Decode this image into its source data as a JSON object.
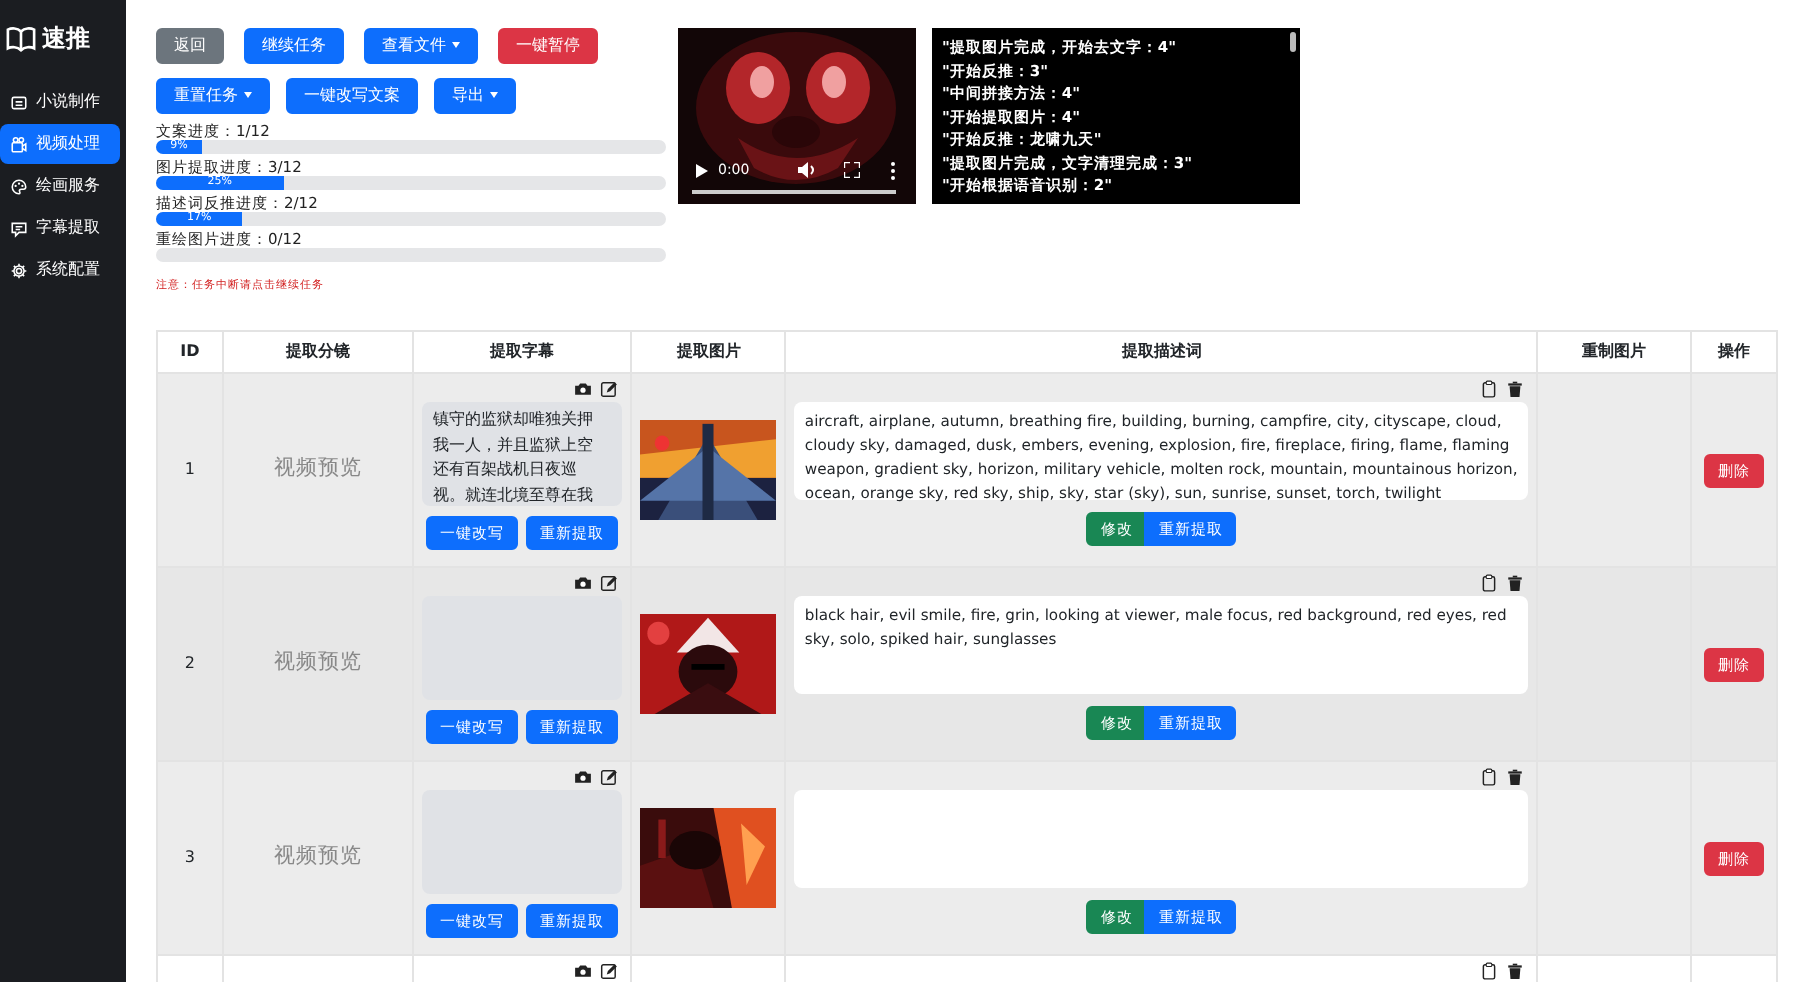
{
  "app": {
    "title": "速推"
  },
  "sidebar": [
    {
      "label": "小说制作",
      "selected": false
    },
    {
      "label": "视频处理",
      "selected": true
    },
    {
      "label": "绘画服务",
      "selected": false
    },
    {
      "label": "字幕提取",
      "selected": false
    },
    {
      "label": "系统配置",
      "selected": false
    }
  ],
  "toolbar": [
    [
      {
        "label": "返回",
        "kind": "secondary",
        "dropdown": false
      },
      {
        "label": "继续任务",
        "kind": "primary",
        "dropdown": false
      },
      {
        "label": "查看文件",
        "kind": "primary",
        "dropdown": true
      },
      {
        "label": "一键暂停",
        "kind": "danger",
        "dropdown": false
      }
    ],
    [
      {
        "label": "重置任务",
        "kind": "primary",
        "dropdown": true
      },
      {
        "label": "一键改写文案",
        "kind": "primary",
        "dropdown": false
      },
      {
        "label": "导出",
        "kind": "primary",
        "dropdown": true
      }
    ]
  ],
  "progress": [
    {
      "label": "文案进度：1/12",
      "level": 0.09,
      "reading": "9%"
    },
    {
      "label": "图片提取进度：3/12",
      "level": 0.25,
      "reading": "25%"
    },
    {
      "label": "描述词反推进度：2/12",
      "level": 0.17,
      "reading": "17%"
    },
    {
      "label": "重绘图片进度：0/12",
      "level": 0
    }
  ],
  "video": {
    "time": "0:00"
  },
  "log": [
    "\"提取图片完成，开始去文字：4\"",
    "\"开始反推：3\"",
    "\"中间拼接方法：4\"",
    "\"开始提取图片：4\"",
    "\"开始反推：龙啸九天\"",
    "\"提取图片完成，文字清理完成：3\"",
    "\"开始根据语音识别：2\""
  ],
  "notice": "注意：任务中断请点击继续任务",
  "table": {
    "columns": [
      "ID",
      "提取分镜",
      "提取字幕",
      "提取图片",
      "提取描述词",
      "重制图片",
      "操作"
    ],
    "rows": [
      {
        "kind": "full",
        "id": "1",
        "preview": "视频预览",
        "subtitle": "镇守的监狱却唯独关押我一人，并且监狱上空还有百架战机日夜巡视。就连北境至尊在我",
        "subtitle_buttons": [
          "一键改写",
          "重新提取"
        ],
        "prompt": "aircraft, airplane, autumn, breathing fire, building, burning, campfire, city, cityscape, cloud, cloudy sky, damaged, dusk, embers, evening, explosion, fire, fireplace, firing, flame, flaming weapon, gradient sky, horizon, military vehicle, molten rock, mountain, mountainous horizon, ocean, orange sky, red sky, ship, sky, star (sky), sun, sunrise, sunset, torch, twilight",
        "prompt_buttons": [
          "修改",
          "重新提取"
        ],
        "action": "删除"
      },
      {
        "kind": "full",
        "id": "2",
        "preview": "视频预览",
        "subtitle_buttons": [
          "一键改写",
          "重新提取"
        ],
        "prompt": "black hair, evil smile, fire, grin, looking at viewer, male focus, red background, red eyes, red sky, solo, spiked hair, sunglasses",
        "prompt_buttons": [
          "修改",
          "重新提取"
        ],
        "action": "删除"
      },
      {
        "kind": "full",
        "id": "3",
        "preview": "视频预览",
        "subtitle_buttons": [
          "一键改写",
          "重新提取"
        ],
        "prompt_buttons": [
          "修改",
          "重新提取"
        ],
        "action": "删除"
      },
      {
        "kind": "partial"
      }
    ]
  }
}
